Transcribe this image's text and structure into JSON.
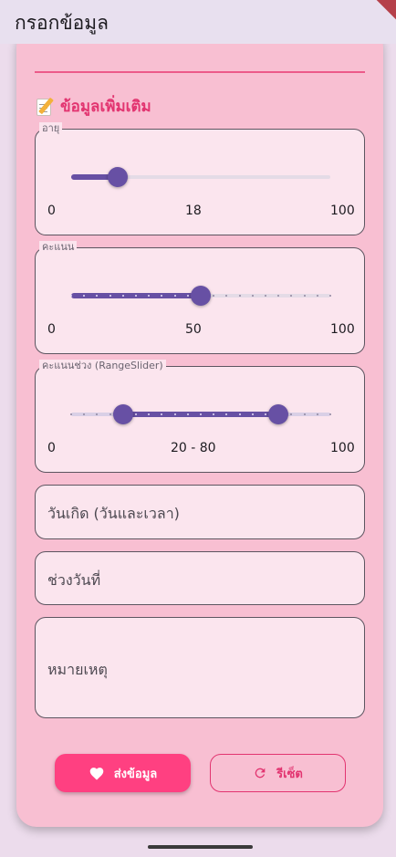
{
  "appbar": {
    "title": "กรอกข้อมูล"
  },
  "section": {
    "title": "ข้อมูลเพิ่มเติม",
    "icon": "memo-icon"
  },
  "sliders": {
    "age": {
      "label": "อายุ",
      "min_label": "0",
      "value_label": "18",
      "max_label": "100",
      "value": 18,
      "min": 0,
      "max": 100
    },
    "score": {
      "label": "คะแนน",
      "min_label": "0",
      "value_label": "50",
      "max_label": "100",
      "value": 50,
      "min": 0,
      "max": 100,
      "divisions": 20
    },
    "range": {
      "label": "คะแนนช่วง (RangeSlider)",
      "min_label": "0",
      "value_label": "20 - 80",
      "max_label": "100",
      "start": 20,
      "end": 80,
      "min": 0,
      "max": 100,
      "divisions": 20
    }
  },
  "fields": {
    "birthdate": {
      "placeholder": "วันเกิด (วันและเวลา)"
    },
    "date_range": {
      "placeholder": "ช่วงวันที่"
    },
    "note": {
      "placeholder": "หมายเหตุ"
    }
  },
  "buttons": {
    "submit": {
      "label": "ส่งข้อมูล",
      "icon": "heart-icon"
    },
    "reset": {
      "label": "รีเซ็ต",
      "icon": "refresh-icon"
    }
  },
  "colors": {
    "accent": "#6750a4",
    "pink": "#ff4081",
    "title_pink": "#e23470",
    "card": "#f8bfd2"
  }
}
